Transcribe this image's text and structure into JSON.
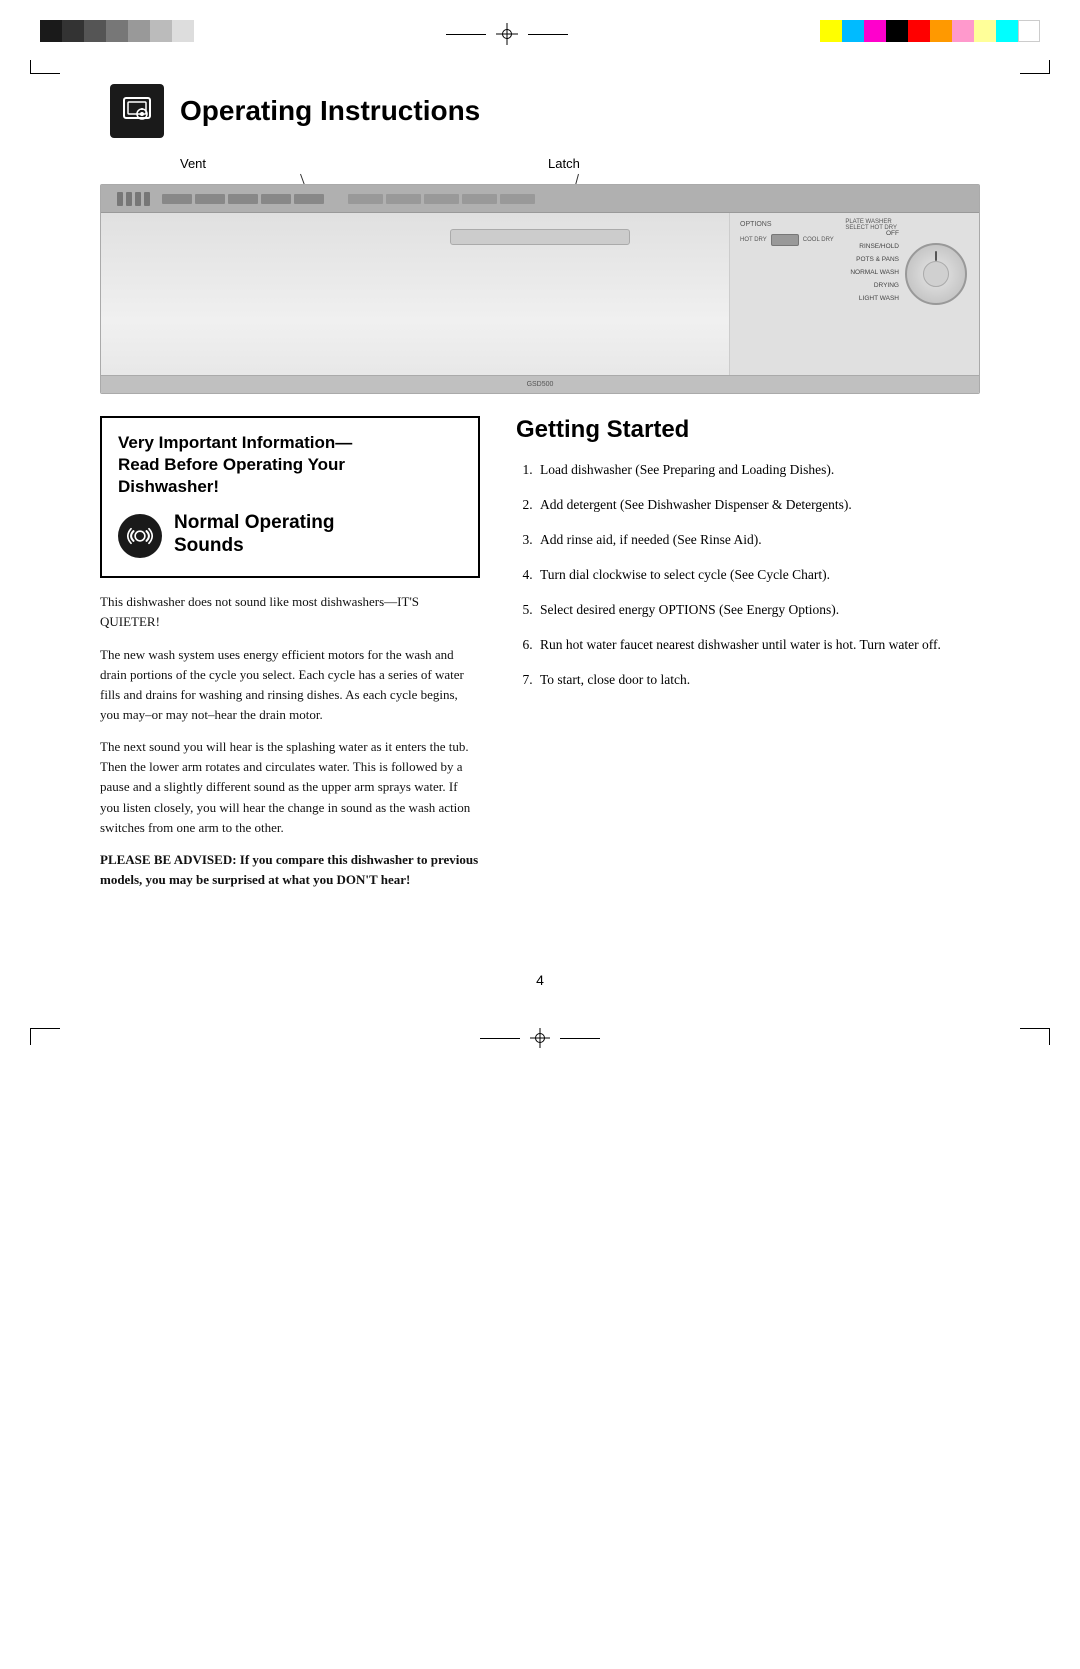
{
  "page": {
    "number": "4",
    "top_color_swatches_left": [
      "#1a1a1a",
      "#333",
      "#555",
      "#777",
      "#999",
      "#bbb",
      "#ddd"
    ],
    "top_color_swatches_right": [
      "#ffff00",
      "#00bbff",
      "#ff00cc",
      "#000000",
      "#ff0000",
      "#ff9900",
      "#ff99cc",
      "#ffff99",
      "#00ffff",
      "#ffffff"
    ]
  },
  "section_header": {
    "title": "Operating Instructions",
    "icon_alt": "dishwasher-settings-icon"
  },
  "diagram": {
    "label_vent": "Vent",
    "label_latch": "Latch"
  },
  "important_box": {
    "title_line1": "Very Important Information—",
    "title_line2": "Read Before Operating Your",
    "title_line3": "Dishwasher!"
  },
  "sounds_section": {
    "title_line1": "Normal Operating",
    "title_line2": "Sounds",
    "icon_alt": "sound-waves-icon"
  },
  "body_paragraphs": {
    "p1": "This dishwasher does not sound like most dishwashers—IT'S QUIETER!",
    "p2": "The new wash system uses energy efficient motors for the wash and drain portions of the cycle you select. Each cycle has a series of water fills and drains for washing and rinsing dishes. As each cycle begins, you may–or may not–hear the drain motor.",
    "p3": "The next sound you will hear is the splashing water as it enters the tub. Then the lower arm rotates and circulates water. This is followed by a pause and a slightly different sound as the upper arm sprays water. If you listen closely, you will hear the change in sound as the wash action switches from one arm to the other.",
    "p4": "PLEASE BE ADVISED: If you compare this dishwasher to previous models, you may be surprised at what you DON'T hear!"
  },
  "getting_started": {
    "title": "Getting Started",
    "steps": [
      "Load dishwasher (See Preparing and Loading Dishes).",
      "Add detergent (See Dishwasher Dispenser & Detergents).",
      "Add rinse aid, if needed (See Rinse Aid).",
      "Turn dial clockwise to select cycle (See Cycle Chart).",
      "Select desired energy OPTIONS (See Energy Options).",
      "Run hot water faucet nearest dishwasher until water is hot. Turn water off.",
      "To start, close door to latch."
    ]
  },
  "dishwasher_diagram": {
    "options_label": "OPTIONS",
    "toggle_hot": "HOT DRY",
    "toggle_cool": "COOL DRY",
    "dial_labels": [
      "OFF",
      "RINSE/HOLD",
      "SELECT HOT DRY",
      "POTS & PANS",
      "NORMAL WASH",
      "DRYING",
      "LIGHT WASH"
    ],
    "model_text": "GSD500"
  }
}
